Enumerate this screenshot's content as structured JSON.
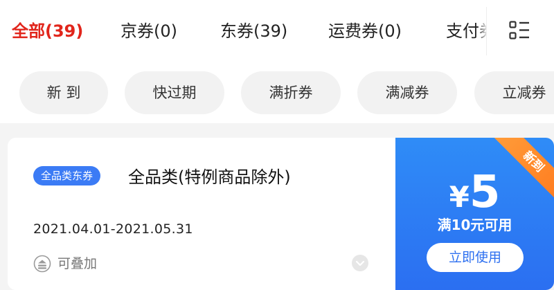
{
  "tabs": [
    {
      "label": "全部(39)",
      "active": true
    },
    {
      "label": "京券(0)",
      "active": false
    },
    {
      "label": "东券(39)",
      "active": false
    },
    {
      "label": "运费券(0)",
      "active": false
    },
    {
      "label": "支付券",
      "active": false
    }
  ],
  "menu_icon": "grid-list-icon",
  "filters": [
    "新 到",
    "快过期",
    "满折券",
    "满减券",
    "立减券"
  ],
  "coupon": {
    "tag": "全品类东券",
    "title": "全品类(特例商品除外)",
    "validity": "2021.04.01-2021.05.31",
    "stack_label": "可叠加",
    "stack_icon": "stack-up-icon",
    "expand_icon": "chevron-down-icon",
    "ribbon": "新到",
    "currency": "¥",
    "amount": "5",
    "threshold": "满10元可用",
    "use_button": "立即使用"
  },
  "colors": {
    "accent_red": "#e1251b",
    "coupon_blue": "#2b6ff1",
    "tag_blue": "#3b7bf5",
    "ribbon_orange": "#ff8a2a"
  }
}
